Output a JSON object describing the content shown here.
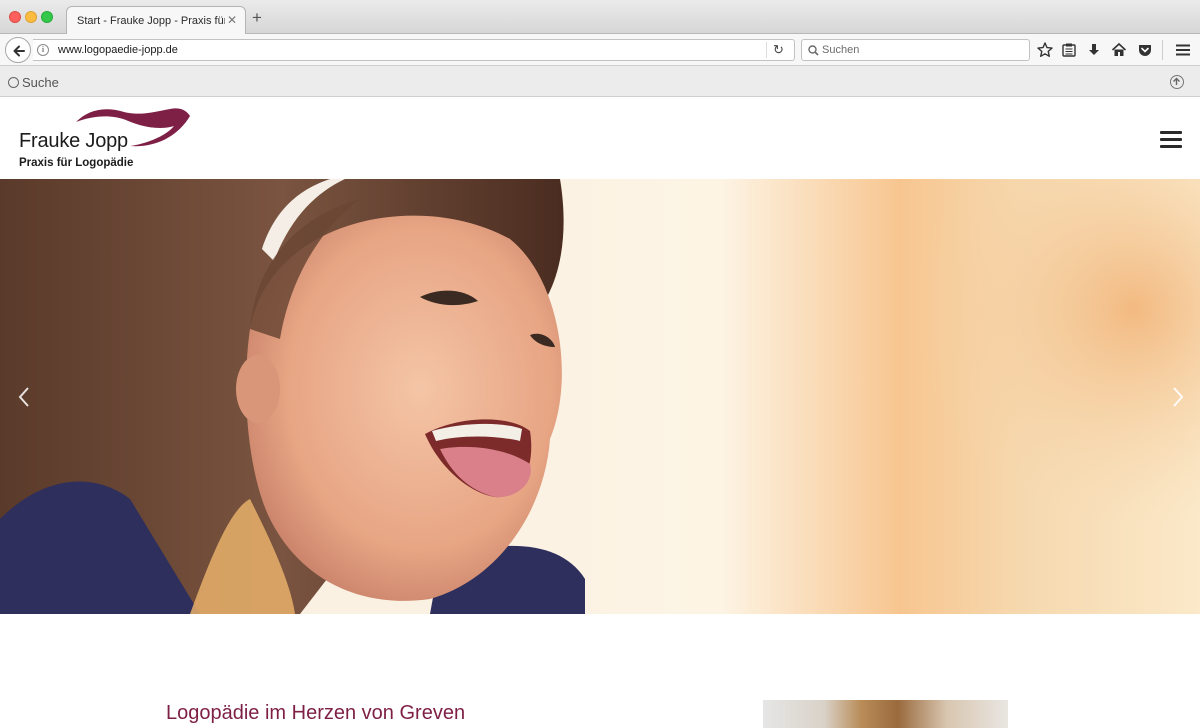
{
  "browser": {
    "tab_title": "Start - Frauke Jopp - Praxis für ...",
    "url": "www.logopaedie-jopp.de",
    "search_placeholder": "Suchen",
    "findbar_label": "Suche"
  },
  "site": {
    "logo_name": "Frauke Jopp",
    "logo_subtitle": "Praxis für Logopädie",
    "brand_color": "#7e1f45",
    "content_heading": "Logopädie im Herzen von Greven"
  }
}
